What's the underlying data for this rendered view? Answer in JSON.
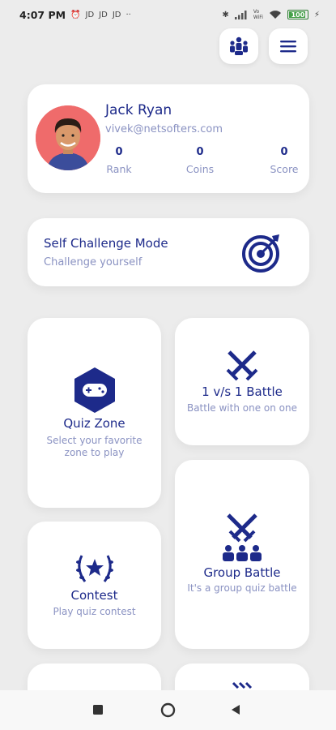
{
  "status_bar": {
    "time": "4:07 PM",
    "indicators": [
      "JD",
      "JD",
      "JD"
    ],
    "more": "··",
    "network": "Vo\nWiFi",
    "battery": "100"
  },
  "header": {
    "leaderboard_icon": "people-group-icon",
    "menu_icon": "hamburger-menu-icon"
  },
  "profile": {
    "name": "Jack Ryan",
    "email": "vivek@netsofters.com",
    "stats": [
      {
        "value": "0",
        "label": "Rank"
      },
      {
        "value": "0",
        "label": "Coins"
      },
      {
        "value": "0",
        "label": "Score"
      }
    ]
  },
  "self_challenge": {
    "title": "Self Challenge Mode",
    "subtitle": "Challenge yourself",
    "icon": "target-icon"
  },
  "tiles": {
    "quiz_zone": {
      "title": "Quiz Zone",
      "subtitle": "Select your favorite zone to play",
      "icon": "gamepad-icon"
    },
    "battle_1v1": {
      "title": "1 v/s 1 Battle",
      "subtitle": "Battle with one on one",
      "icon": "crossed-swords-icon"
    },
    "contest": {
      "title": "Contest",
      "subtitle": "Play quiz contest",
      "icon": "laurel-star-icon"
    },
    "group_battle": {
      "title": "Group Battle",
      "subtitle": "It's a group quiz battle",
      "icon": "group-swords-icon"
    }
  },
  "colors": {
    "primary": "#1d2a8a",
    "muted": "#8a92c2",
    "background": "#ececec",
    "card": "#ffffff",
    "avatar_bg": "#ef6b6b"
  }
}
